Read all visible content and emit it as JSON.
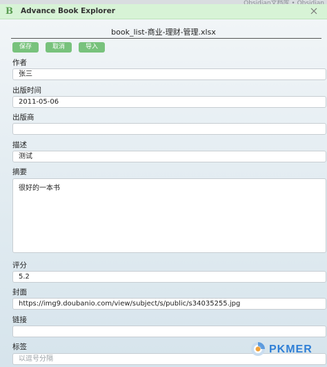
{
  "background": {
    "top_text": "Obsidian文档库 • Obsidian"
  },
  "window": {
    "title": "Advance Book Explorer",
    "logo_letter": "B"
  },
  "file_title": "book_list-商业-理财-管理.xlsx",
  "toolbar": {
    "save_label": "保存",
    "cancel_label": "取消",
    "import_label": "导入"
  },
  "fields": {
    "author": {
      "label": "作者",
      "value": "张三"
    },
    "publish_date": {
      "label": "出版时间",
      "value": "2011-05-06"
    },
    "publisher": {
      "label": "出版商",
      "value": ""
    },
    "description": {
      "label": "描述",
      "value": "测试"
    },
    "summary": {
      "label": "摘要",
      "value": "很好的一本书"
    },
    "rating": {
      "label": "评分",
      "value": "5.2"
    },
    "cover": {
      "label": "封面",
      "value": "https://img9.doubanio.com/view/subject/s/public/s34035255.jpg"
    },
    "link": {
      "label": "链接",
      "value": ""
    },
    "tags": {
      "label": "标签",
      "placeholder": "以逗号分隔"
    }
  },
  "watermark": {
    "text": "PKMER"
  },
  "colors": {
    "titlebar": "#d7f3d6",
    "button": "#78c27c",
    "logo": "#5a9c52",
    "watermark": "#2f7fd6"
  }
}
